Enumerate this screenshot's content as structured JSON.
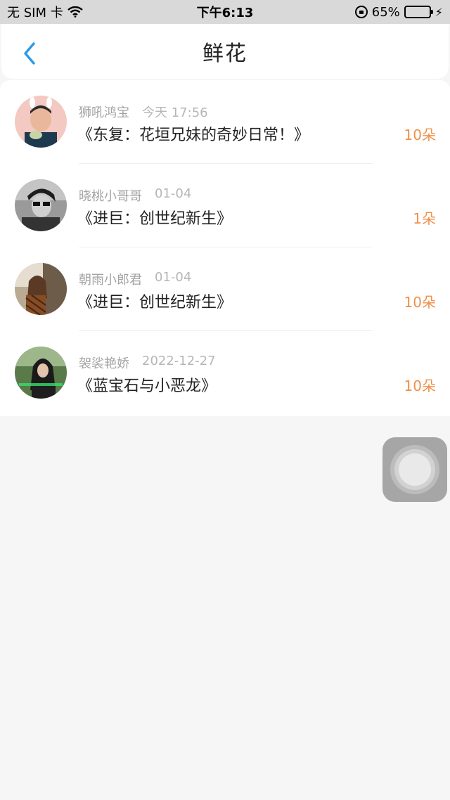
{
  "status_bar": {
    "carrier": "无 SIM 卡",
    "time": "下午6:13",
    "battery_percent": "65%",
    "battery_level": 0.65,
    "icons": [
      "wifi-icon",
      "orientation-lock-icon",
      "battery-icon",
      "charging-bolt-icon"
    ]
  },
  "nav": {
    "title": "鲜花",
    "back_icon": "chevron-left-icon",
    "accent_color": "#2a9ae8"
  },
  "colors": {
    "count_color": "#f0904a",
    "secondary_text": "#a3a3a3"
  },
  "list": [
    {
      "user": "狮吼鸿宝",
      "date": "今天 17:56",
      "book": "《东复：花垣兄妹的奇妙日常！》",
      "count": "10朵",
      "avatar": "avatar-1"
    },
    {
      "user": "晓桃小哥哥",
      "date": "01-04",
      "book": "《进巨：创世纪新生》",
      "count": "1朵",
      "avatar": "avatar-2"
    },
    {
      "user": "朝雨小郎君",
      "date": "01-04",
      "book": "《进巨：创世纪新生》",
      "count": "10朵",
      "avatar": "avatar-3"
    },
    {
      "user": "袈裟艳娇",
      "date": "2022-12-27",
      "book": "《蓝宝石与小恶龙》",
      "count": "10朵",
      "avatar": "avatar-4"
    }
  ]
}
